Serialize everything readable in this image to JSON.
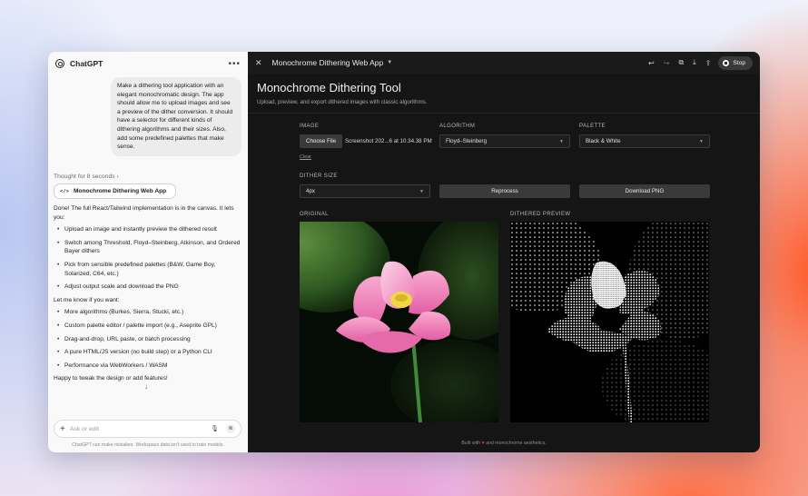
{
  "chat": {
    "header_title": "ChatGPT",
    "menu_icon": "more-dots-icon",
    "user_message": "Make a dithering tool application with an elegant monochromatic design. The app should allow me to upload images and see a preview of the dither conversion. It should have a selector for different kinds of dithering algorithms and their sizes. Also, add some predefined palettes that make sense.",
    "thought_label": "Thought for 8 seconds",
    "artifact_button": "Monochrome Dithering Web App",
    "reply_intro": "Done! The full React/Tailwind implementation is in the canvas. It lets you:",
    "reply_points": [
      "Upload an image and instantly preview the dithered result",
      "Switch among Threshold, Floyd–Steinberg, Atkinson, and Ordered Bayer dithers",
      "Pick from sensible predefined palettes (B&W, Game Boy, Solarized, C64, etc.)",
      "Adjust output scale and download the PNG"
    ],
    "reply_followup": "Let me know if you want:",
    "reply_options": [
      "More algorithms (Burkes, Sierra, Stucki, etc.)",
      "Custom palette editor / palette import (e.g., Aseprite GPL)",
      "Drag-and-drop, URL paste, or batch processing",
      "A pure HTML/JS version (no build step) or a Python CLI",
      "Performance via WebWorkers / WASM"
    ],
    "reply_closing": "Happy to tweak the design or add features!",
    "composer_placeholder": "Ask or edit",
    "disclaimer": "ChatGPT can make mistakes. Workspace data isn't used to train models."
  },
  "canvas": {
    "title": "Monochrome Dithering Web App",
    "stop_label": "Stop",
    "app_title": "Monochrome Dithering Tool",
    "app_subtitle": "Upload, preview, and export dithered images with classic algorithms.",
    "image_label": "IMAGE",
    "choose_file": "Choose File",
    "file_name": "Screenshot 202...6 at 10.34.38 PM",
    "clear_label": "Clear",
    "algorithm_label": "ALGORITHM",
    "algorithm_value": "Floyd–Steinberg",
    "palette_label": "PALETTE",
    "palette_value": "Black & White",
    "dither_size_label": "DITHER SIZE",
    "dither_size_value": "4px",
    "reprocess_label": "Reprocess",
    "download_label": "Download PNG",
    "original_label": "ORIGINAL",
    "preview_label": "DITHERED PREVIEW",
    "footer_prefix": "Built with",
    "footer_suffix": "and monochrome aesthetics."
  },
  "colors": {
    "canvas_bg": "#151515",
    "chat_bg": "#f9f9f9",
    "accent_heart": "#e23b3b",
    "lotus_pink": "#f07ab8"
  }
}
